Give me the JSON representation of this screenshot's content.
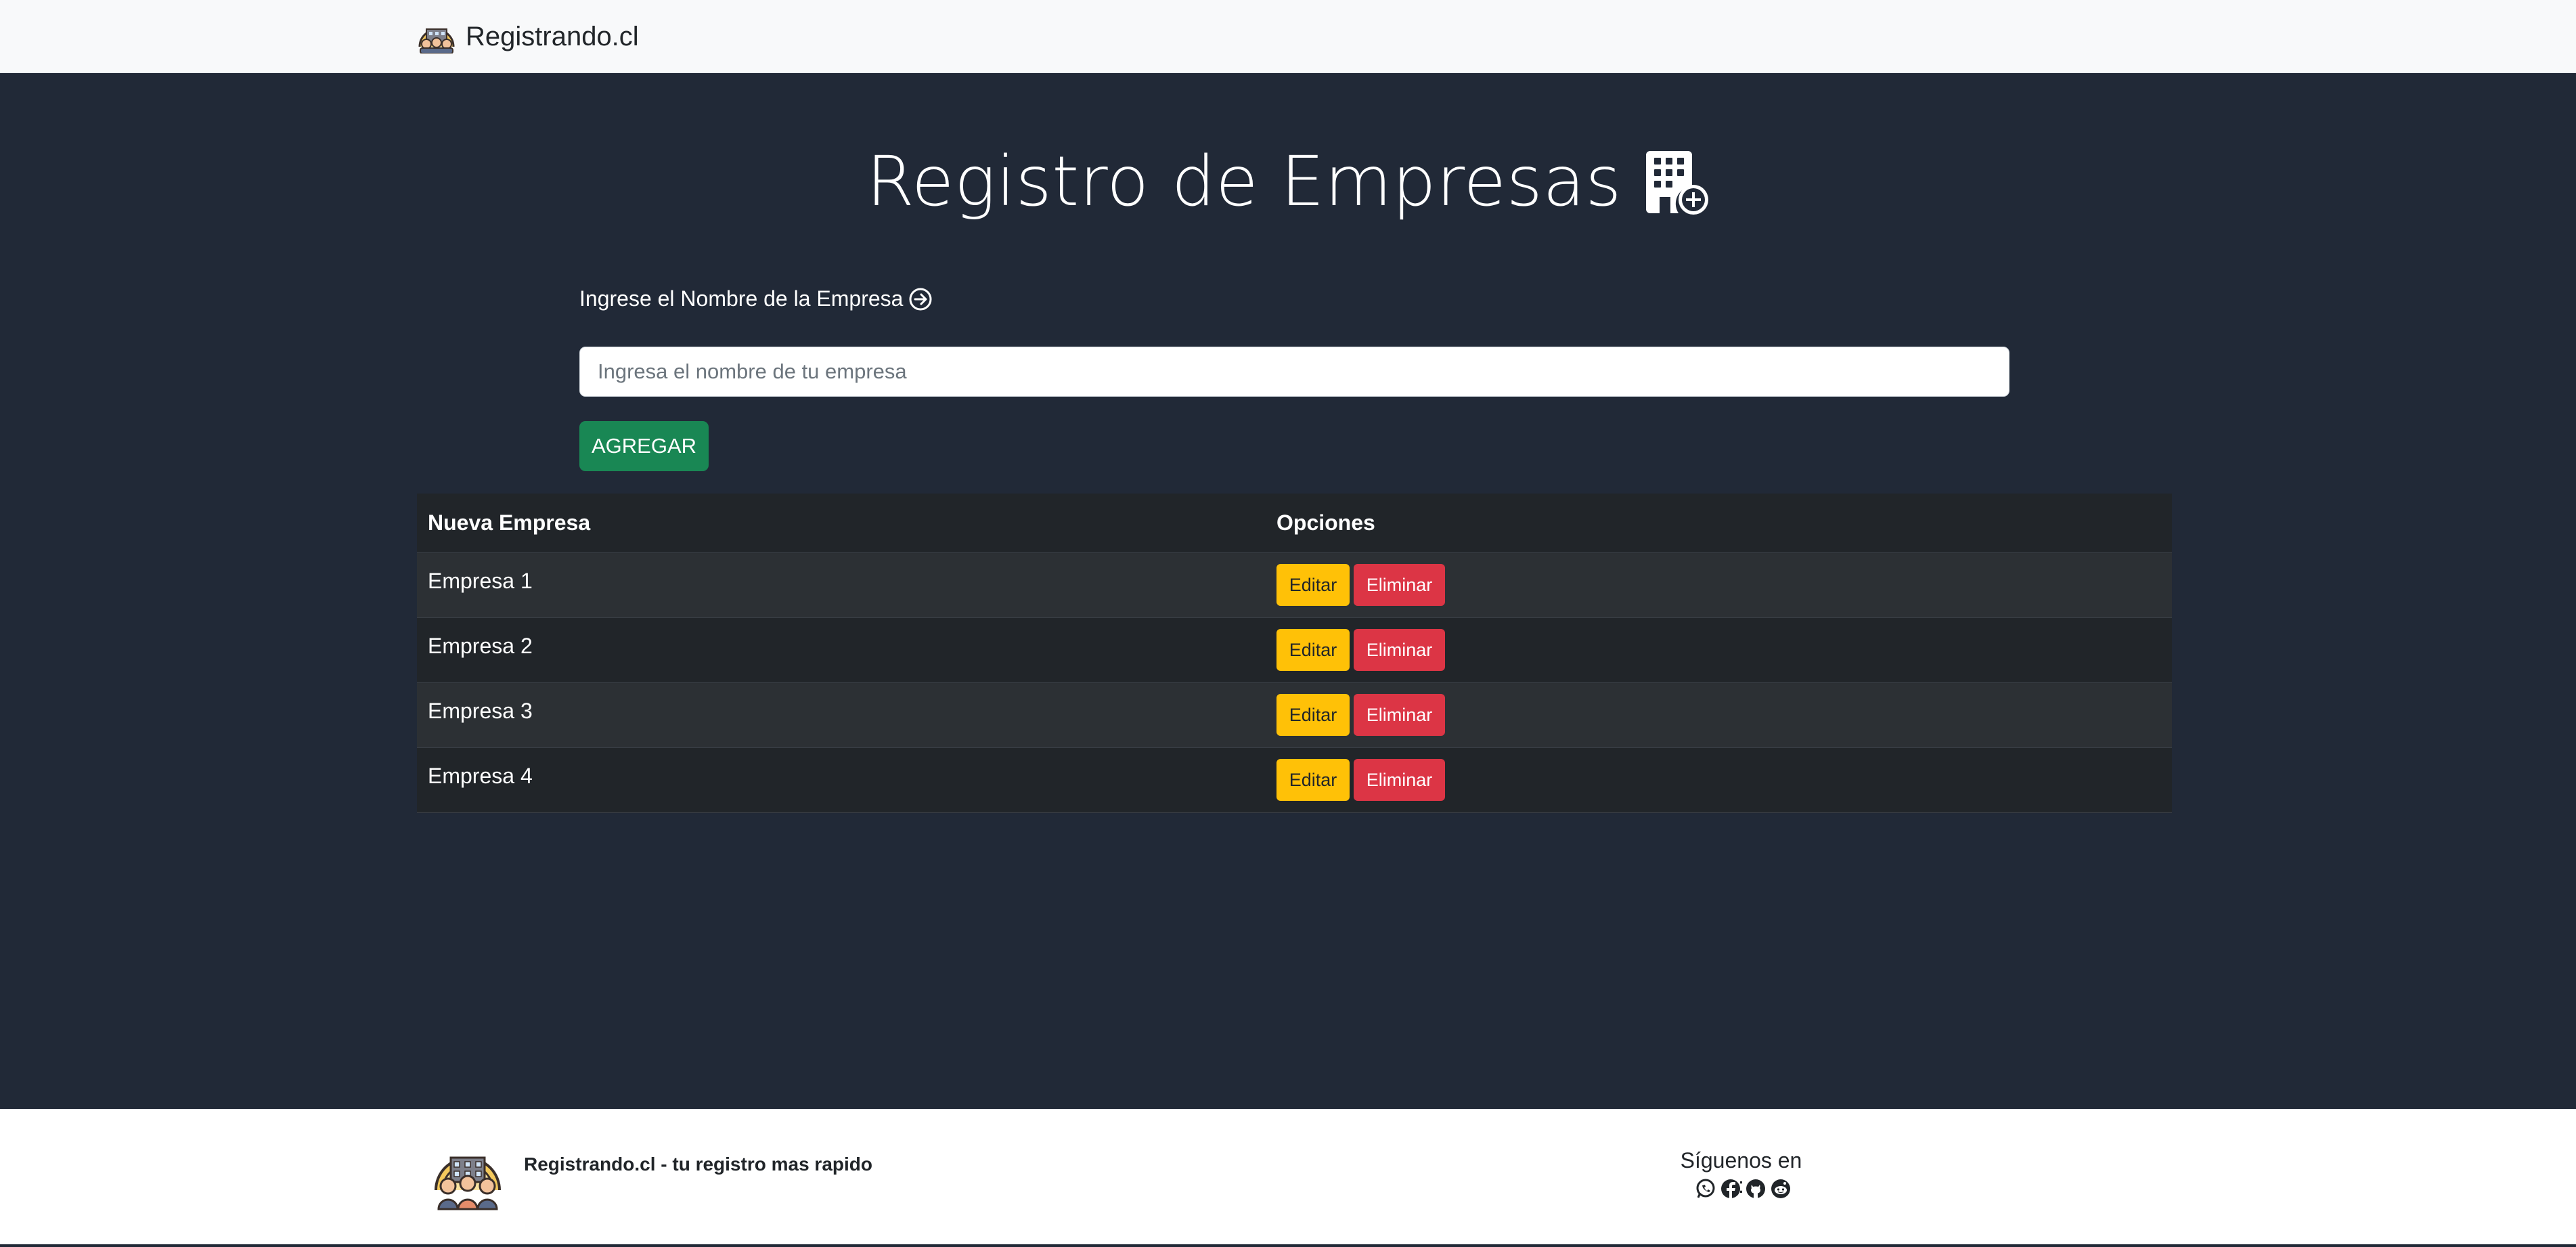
{
  "navbar": {
    "brand_text": "Registrando.cl",
    "logo_icon": "team-building-logo-icon"
  },
  "main": {
    "title": "Registro de Empresas",
    "title_icon": "building-add-icon",
    "label": "Ingrese el Nombre de la Empresa",
    "label_icon": "arrow-right-circle-icon",
    "input_placeholder": "Ingresa el nombre de tu empresa",
    "input_value": "",
    "add_button": "AGREGAR"
  },
  "table": {
    "headers": [
      "Nueva Empresa",
      "Opciones"
    ],
    "rows": [
      {
        "name": "Empresa 1",
        "edit": "Editar",
        "delete": "Eliminar"
      },
      {
        "name": "Empresa 2",
        "edit": "Editar",
        "delete": "Eliminar"
      },
      {
        "name": "Empresa 3",
        "edit": "Editar",
        "delete": "Eliminar"
      },
      {
        "name": "Empresa 4",
        "edit": "Editar",
        "delete": "Eliminar"
      }
    ]
  },
  "footer": {
    "tagline": "Registrando.cl - tu registro mas rapido",
    "follow_text": "Síguenos en :",
    "social_icons": [
      "whatsapp-icon",
      "facebook-icon",
      "github-icon",
      "reddit-icon"
    ]
  },
  "colors": {
    "page_background": "#212937",
    "navbar_background": "#f8f9fa",
    "add_button": "#198754",
    "edit_button": "#ffc107",
    "delete_button": "#dc3545",
    "table_dark": "#212529",
    "table_striped": "#2c3034"
  }
}
